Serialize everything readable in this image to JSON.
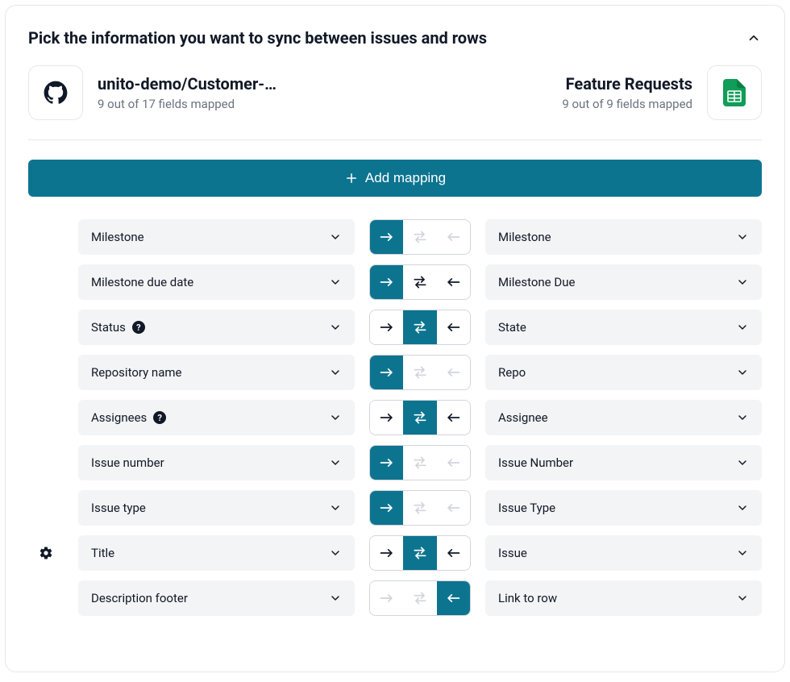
{
  "title": "Pick the information you want to sync between issues and rows",
  "left_source": {
    "name": "unito-demo/Customer-…",
    "sub": "9 out of 17 fields mapped"
  },
  "right_source": {
    "name": "Feature Requests",
    "sub": "9 out of 9 fields mapped"
  },
  "add_button": "Add mapping",
  "mappings": [
    {
      "left": "Milestone",
      "right": "Milestone",
      "dir": "right",
      "disabled_others": true,
      "gear": false,
      "help_left": false
    },
    {
      "left": "Milestone due date",
      "right": "Milestone Due",
      "dir": "right",
      "disabled_others": false,
      "gear": false,
      "help_left": false
    },
    {
      "left": "Status",
      "right": "State",
      "dir": "both",
      "disabled_others": false,
      "gear": false,
      "help_left": true
    },
    {
      "left": "Repository name",
      "right": "Repo",
      "dir": "right",
      "disabled_others": true,
      "gear": false,
      "help_left": false
    },
    {
      "left": "Assignees",
      "right": "Assignee",
      "dir": "both",
      "disabled_others": false,
      "gear": false,
      "help_left": true
    },
    {
      "left": "Issue number",
      "right": "Issue Number",
      "dir": "right",
      "disabled_others": true,
      "gear": false,
      "help_left": false
    },
    {
      "left": "Issue type",
      "right": "Issue Type",
      "dir": "right",
      "disabled_others": true,
      "gear": false,
      "help_left": false
    },
    {
      "left": "Title",
      "right": "Issue",
      "dir": "both",
      "disabled_others": false,
      "gear": true,
      "help_left": false
    },
    {
      "left": "Description footer",
      "right": "Link to row",
      "dir": "left",
      "disabled_others": true,
      "gear": false,
      "help_left": false
    }
  ]
}
